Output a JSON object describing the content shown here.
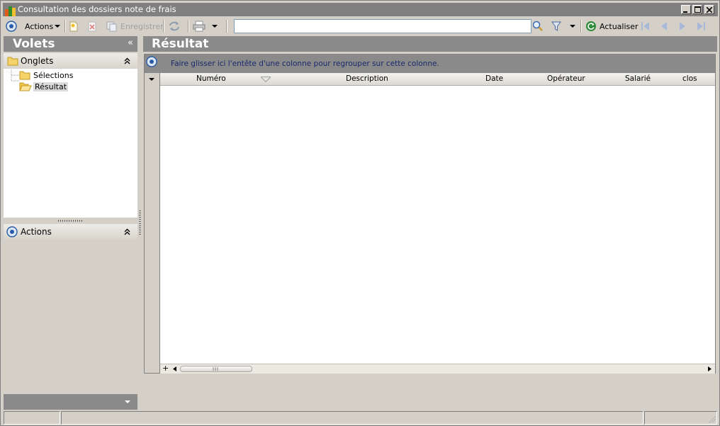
{
  "window": {
    "title": "Consultation des dossiers note de frais"
  },
  "toolbar": {
    "actions_label": "Actions",
    "save_label": "Enregistrer",
    "search_value": "",
    "refresh_label": "Actualiser"
  },
  "left_pane": {
    "title": "Volets",
    "onglets_label": "Onglets",
    "tree_items": [
      {
        "label": "Sélections",
        "selected": false
      },
      {
        "label": "Résultat",
        "selected": true
      }
    ],
    "actions_label": "Actions"
  },
  "result": {
    "title": "Résultat",
    "group_hint": "Faire glisser ici l'entête d'une colonne pour regrouper sur cette colonne.",
    "columns": [
      "Numéro",
      "Description",
      "Date",
      "Opérateur",
      "Salarié",
      "clos"
    ],
    "rows": []
  },
  "colors": {
    "title_bar": "#808080",
    "pane_header": "#8a8a8a",
    "group_text": "#1a2a6c",
    "window_bg": "#d4d0c8"
  },
  "icons": {
    "app": "app-icon",
    "minimize": "minimize-icon",
    "maximize": "maximize-icon",
    "close": "close-icon",
    "nav": "circle-target-icon",
    "new": "new-document-icon",
    "delete": "delete-icon",
    "save": "save-icon",
    "sync": "sync-icon",
    "print": "printer-icon",
    "search": "magnifier-icon",
    "filter": "funnel-icon",
    "refresh": "refresh-icon",
    "first": "first-record-icon",
    "prev": "previous-record-icon",
    "next": "next-record-icon",
    "last": "last-record-icon",
    "folder": "folder-icon",
    "open_folder": "open-folder-icon"
  }
}
